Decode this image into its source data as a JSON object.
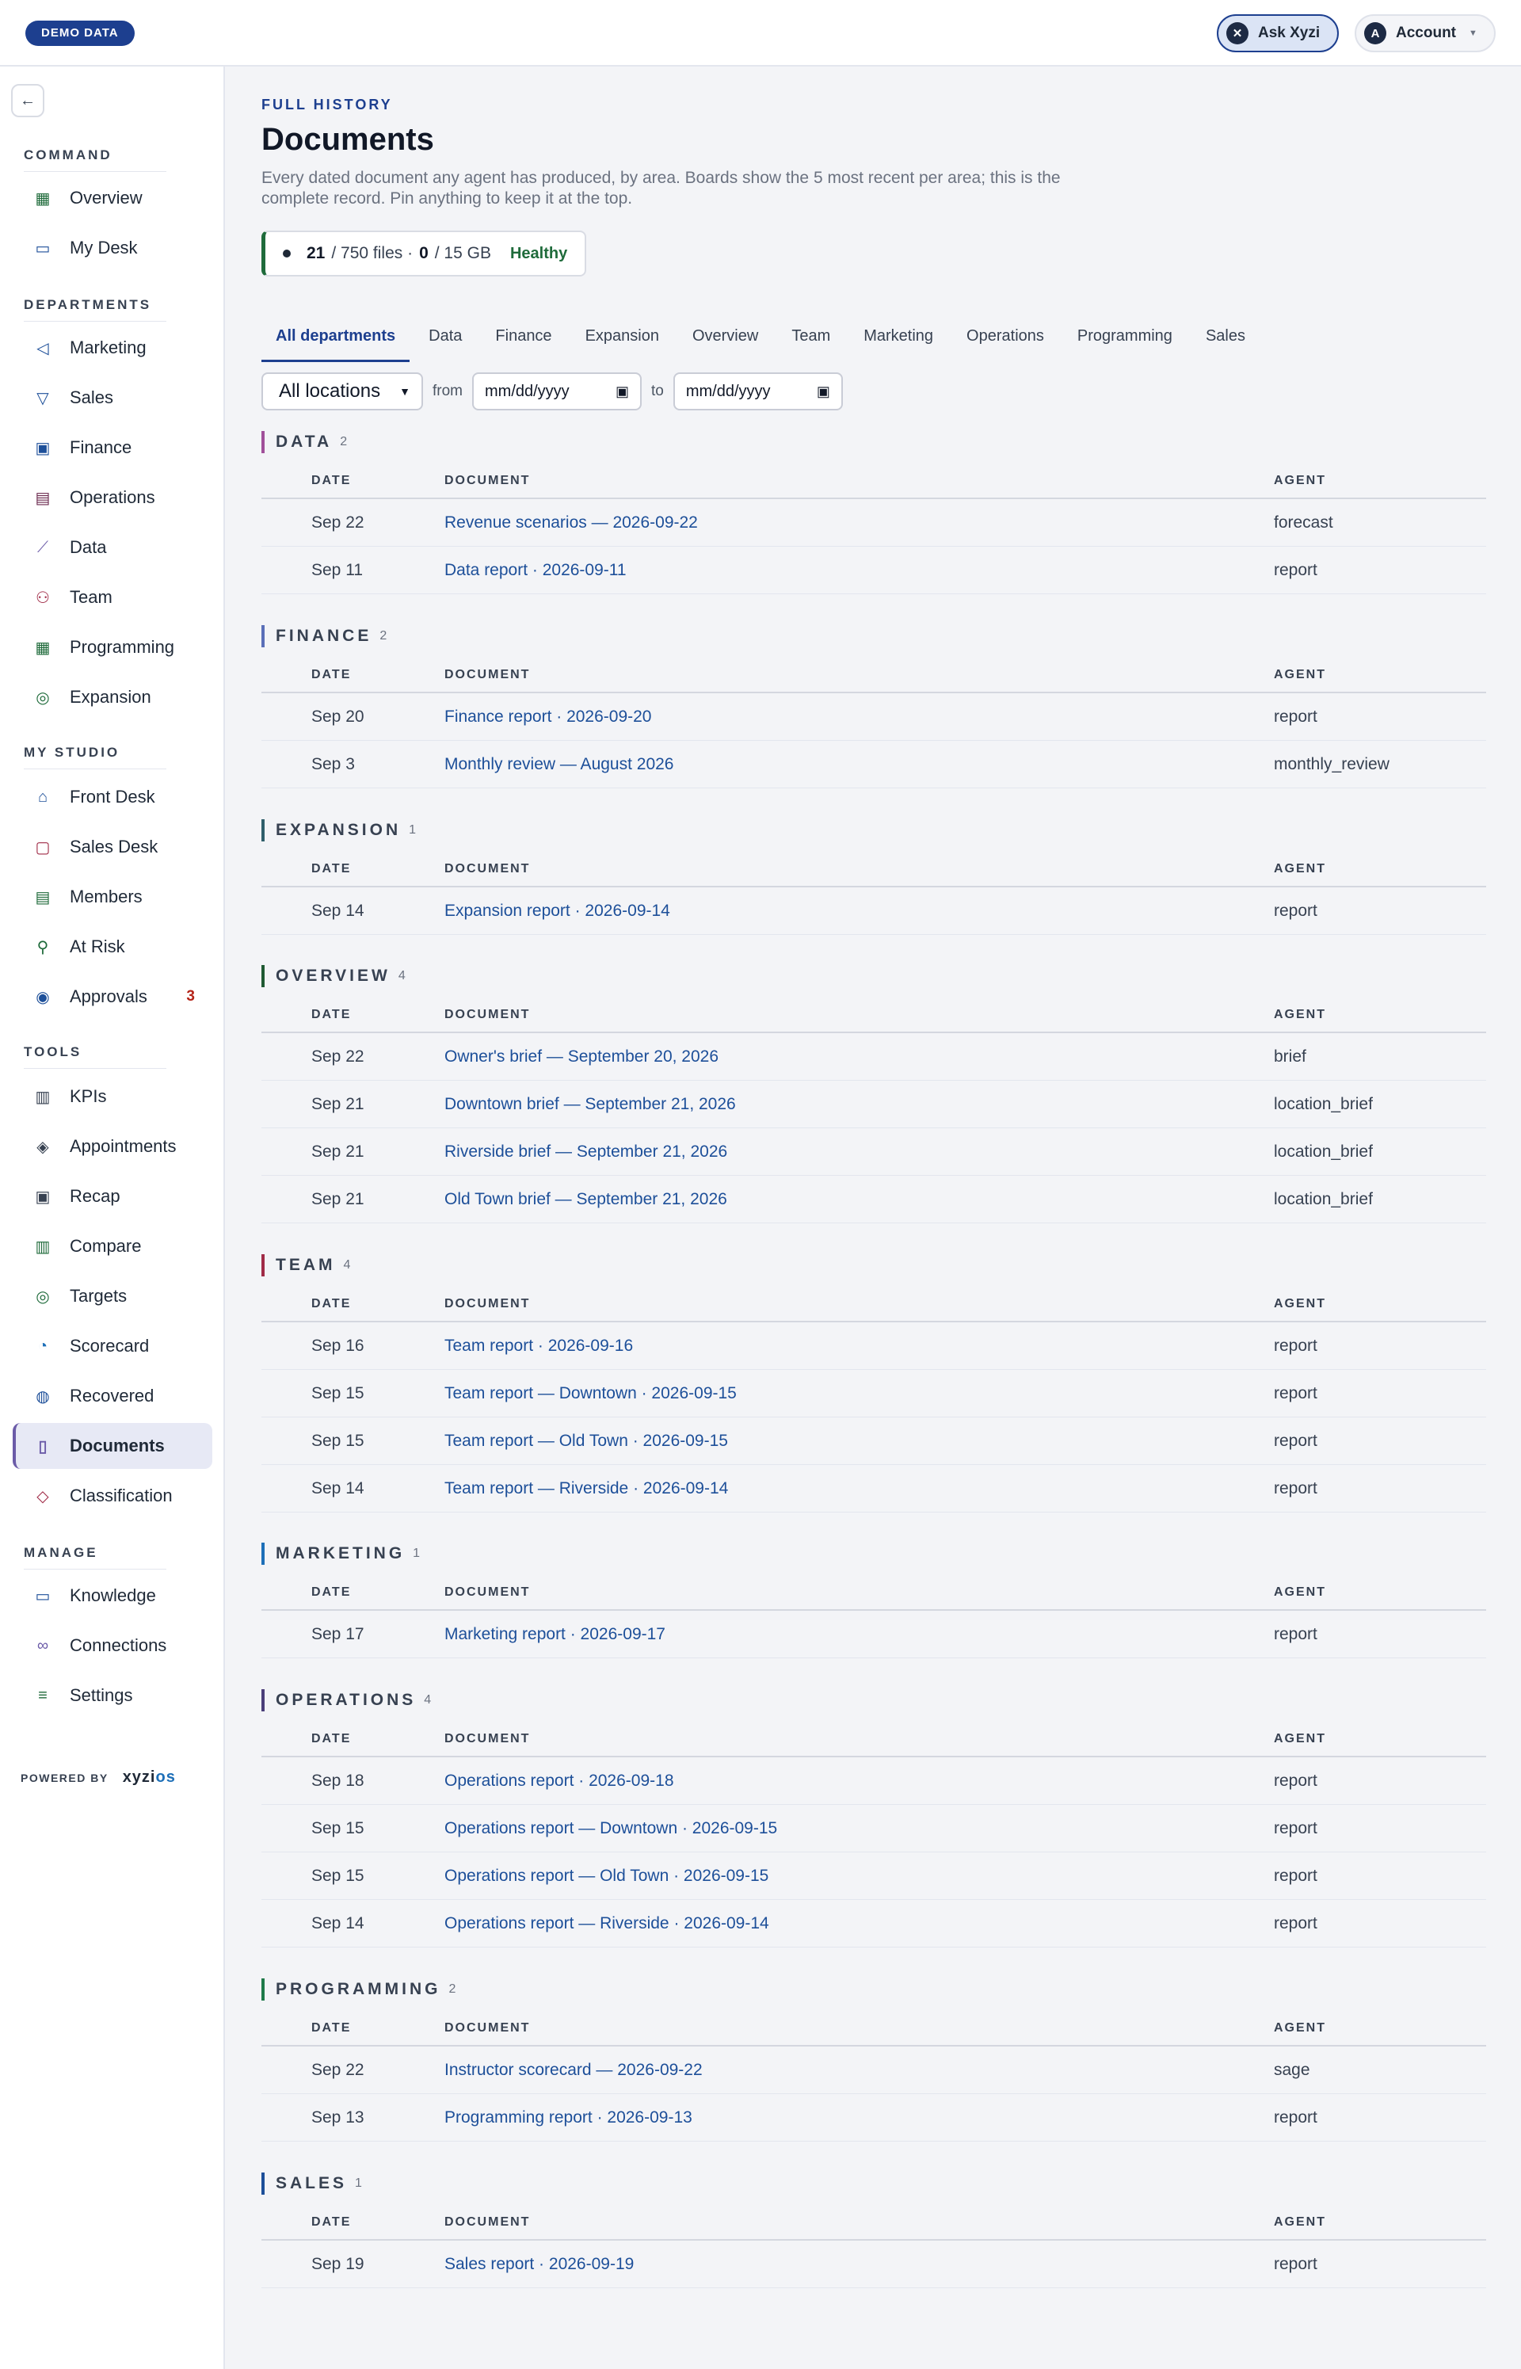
{
  "topbar": {
    "demo_badge": "DEMO DATA",
    "ask_label": "Ask Xyzi",
    "ask_icon": "xyzi-icon",
    "account_label": "Account",
    "account_initial": "A"
  },
  "sidebar": {
    "sections": [
      {
        "title": "COMMAND",
        "items": [
          {
            "label": "Overview",
            "icon": "grid-icon",
            "color": "#1f6b3b"
          },
          {
            "label": "My Desk",
            "icon": "inbox-icon",
            "color": "#1d4f99"
          }
        ]
      },
      {
        "title": "DEPARTMENTS",
        "items": [
          {
            "label": "Marketing",
            "icon": "megaphone-icon",
            "color": "#1d4f99"
          },
          {
            "label": "Sales",
            "icon": "filter-icon",
            "color": "#1d4f99"
          },
          {
            "label": "Finance",
            "icon": "banknote-icon",
            "color": "#1d4f99"
          },
          {
            "label": "Operations",
            "icon": "clipboard-icon",
            "color": "#6b2a4f"
          },
          {
            "label": "Data",
            "icon": "line-chart-icon",
            "color": "#6b5ba8"
          },
          {
            "label": "Team",
            "icon": "users-icon",
            "color": "#a02b47"
          },
          {
            "label": "Programming",
            "icon": "calendar-icon",
            "color": "#1f6b3b"
          },
          {
            "label": "Expansion",
            "icon": "compass-icon",
            "color": "#1f6b3b"
          }
        ]
      },
      {
        "title": "MY STUDIO",
        "items": [
          {
            "label": "Front Desk",
            "icon": "bell-icon",
            "color": "#1d4f99"
          },
          {
            "label": "Sales Desk",
            "icon": "chat-icon",
            "color": "#a02b47"
          },
          {
            "label": "Members",
            "icon": "id-card-icon",
            "color": "#1f6b3b"
          },
          {
            "label": "At Risk",
            "icon": "user-alert-icon",
            "color": "#1f6b3b"
          },
          {
            "label": "Approvals",
            "icon": "check-circle-icon",
            "color": "#1d4f99",
            "badge": "3"
          }
        ]
      },
      {
        "title": "TOOLS",
        "items": [
          {
            "label": "KPIs",
            "icon": "bar-chart-icon",
            "color": "#374151"
          },
          {
            "label": "Appointments",
            "icon": "layers-icon",
            "color": "#374151"
          },
          {
            "label": "Recap",
            "icon": "recap-icon",
            "color": "#374151"
          },
          {
            "label": "Compare",
            "icon": "compare-icon",
            "color": "#1f6b3b"
          },
          {
            "label": "Targets",
            "icon": "target-icon",
            "color": "#1f6b3b"
          },
          {
            "label": "Scorecard",
            "icon": "gauge-icon",
            "color": "#1d6fb8"
          },
          {
            "label": "Recovered",
            "icon": "dollar-icon",
            "color": "#1d4f99"
          },
          {
            "label": "Documents",
            "icon": "document-icon",
            "color": "#6b5ba8",
            "active": true
          },
          {
            "label": "Classification",
            "icon": "tag-icon",
            "color": "#a02b47"
          }
        ]
      },
      {
        "title": "MANAGE",
        "items": [
          {
            "label": "Knowledge",
            "icon": "book-icon",
            "color": "#1d4f99"
          },
          {
            "label": "Connections",
            "icon": "link-icon",
            "color": "#6b5ba8"
          },
          {
            "label": "Settings",
            "icon": "sliders-icon",
            "color": "#1f6b3b"
          }
        ]
      }
    ],
    "powered_by": "POWERED BY",
    "logo_main": "xyzi",
    "logo_accent": "os"
  },
  "main": {
    "eyebrow": "FULL HISTORY",
    "title": "Documents",
    "subtitle": "Every dated document any agent has produced, by area. Boards show the 5 most recent per area; this is the complete record. Pin anything to keep it at the top.",
    "storage": {
      "files_used": "21",
      "files_rest": "/ 750 files ·",
      "gb_used": "0",
      "gb_rest": "/ 15 GB",
      "health": "Healthy"
    },
    "tabs": [
      "All departments",
      "Data",
      "Finance",
      "Expansion",
      "Overview",
      "Team",
      "Marketing",
      "Operations",
      "Programming",
      "Sales"
    ],
    "filters": {
      "location": "All locations",
      "from_label": "from",
      "to_label": "to",
      "from_value": "mm/dd/yyyy",
      "to_value": "mm/dd/yyyy"
    },
    "columns": {
      "date": "DATE",
      "document": "DOCUMENT",
      "agent": "AGENT"
    },
    "sections": [
      {
        "name": "DATA",
        "count": "2",
        "color": "#a0509a",
        "rows": [
          {
            "date": "Sep 22",
            "doc": "Revenue scenarios — 2026-09-22",
            "agent": "forecast"
          },
          {
            "date": "Sep 11",
            "doc": "Data report · 2026-09-11",
            "agent": "report"
          }
        ]
      },
      {
        "name": "FINANCE",
        "count": "2",
        "color": "#5a6fb8",
        "rows": [
          {
            "date": "Sep 20",
            "doc": "Finance report · 2026-09-20",
            "agent": "report"
          },
          {
            "date": "Sep 3",
            "doc": "Monthly review — August 2026",
            "agent": "monthly_review"
          }
        ]
      },
      {
        "name": "EXPANSION",
        "count": "1",
        "color": "#2f5f6b",
        "rows": [
          {
            "date": "Sep 14",
            "doc": "Expansion report · 2026-09-14",
            "agent": "report"
          }
        ]
      },
      {
        "name": "OVERVIEW",
        "count": "4",
        "color": "#1f5a33",
        "rows": [
          {
            "date": "Sep 22",
            "doc": "Owner's brief — September 20, 2026",
            "agent": "brief"
          },
          {
            "date": "Sep 21",
            "doc": "Downtown brief — September 21, 2026",
            "agent": "location_brief"
          },
          {
            "date": "Sep 21",
            "doc": "Riverside brief — September 21, 2026",
            "agent": "location_brief"
          },
          {
            "date": "Sep 21",
            "doc": "Old Town brief — September 21, 2026",
            "agent": "location_brief"
          }
        ]
      },
      {
        "name": "TEAM",
        "count": "4",
        "color": "#a02b47",
        "rows": [
          {
            "date": "Sep 16",
            "doc": "Team report · 2026-09-16",
            "agent": "report"
          },
          {
            "date": "Sep 15",
            "doc": "Team report — Downtown · 2026-09-15",
            "agent": "report"
          },
          {
            "date": "Sep 15",
            "doc": "Team report — Old Town · 2026-09-15",
            "agent": "report"
          },
          {
            "date": "Sep 14",
            "doc": "Team report — Riverside · 2026-09-14",
            "agent": "report"
          }
        ]
      },
      {
        "name": "MARKETING",
        "count": "1",
        "color": "#1d6fb8",
        "rows": [
          {
            "date": "Sep 17",
            "doc": "Marketing report · 2026-09-17",
            "agent": "report"
          }
        ]
      },
      {
        "name": "OPERATIONS",
        "count": "4",
        "color": "#4b3f7a",
        "rows": [
          {
            "date": "Sep 18",
            "doc": "Operations report · 2026-09-18",
            "agent": "report"
          },
          {
            "date": "Sep 15",
            "doc": "Operations report — Downtown · 2026-09-15",
            "agent": "report"
          },
          {
            "date": "Sep 15",
            "doc": "Operations report — Old Town · 2026-09-15",
            "agent": "report"
          },
          {
            "date": "Sep 14",
            "doc": "Operations report — Riverside · 2026-09-14",
            "agent": "report"
          }
        ]
      },
      {
        "name": "PROGRAMMING",
        "count": "2",
        "color": "#1f7a4a",
        "rows": [
          {
            "date": "Sep 22",
            "doc": "Instructor scorecard — 2026-09-22",
            "agent": "sage"
          },
          {
            "date": "Sep 13",
            "doc": "Programming report · 2026-09-13",
            "agent": "report"
          }
        ]
      },
      {
        "name": "SALES",
        "count": "1",
        "color": "#1d4f99",
        "rows": [
          {
            "date": "Sep 19",
            "doc": "Sales report · 2026-09-19",
            "agent": "report"
          }
        ]
      }
    ]
  }
}
